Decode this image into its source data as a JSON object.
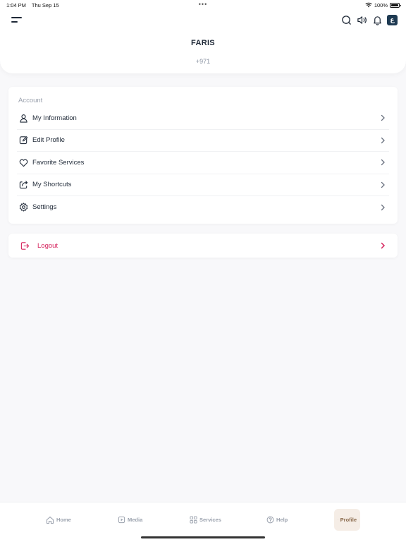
{
  "status": {
    "time": "1:04 PM",
    "date": "Thu Sep 15",
    "battery_label": "100%",
    "battery_level": 1.0
  },
  "profile": {
    "name": "FARIS",
    "phone": "+971"
  },
  "account": {
    "section_title": "Account",
    "items": [
      {
        "label": "My Information",
        "icon": "user-icon"
      },
      {
        "label": "Edit Profile",
        "icon": "edit-icon"
      },
      {
        "label": "Favorite Services",
        "icon": "heart-icon"
      },
      {
        "label": "My Shortcuts",
        "icon": "share-icon"
      },
      {
        "label": "Settings",
        "icon": "gear-icon"
      }
    ]
  },
  "logout": {
    "label": "Logout",
    "color": "#d6265f"
  },
  "language": {
    "label": "ع"
  },
  "tabs": [
    {
      "label": "Home",
      "icon": "home-icon",
      "active": false
    },
    {
      "label": "Media",
      "icon": "media-icon",
      "active": false
    },
    {
      "label": "Services",
      "icon": "grid-icon",
      "active": false
    },
    {
      "label": "Help",
      "icon": "help-icon",
      "active": false
    },
    {
      "label": "Profile",
      "icon": "user-icon",
      "active": true
    }
  ],
  "colors": {
    "accent": "#8a6a4c",
    "active_tab_bg": "#f5ede6",
    "text_primary": "#1f2937",
    "text_muted": "#9aa1ad"
  }
}
